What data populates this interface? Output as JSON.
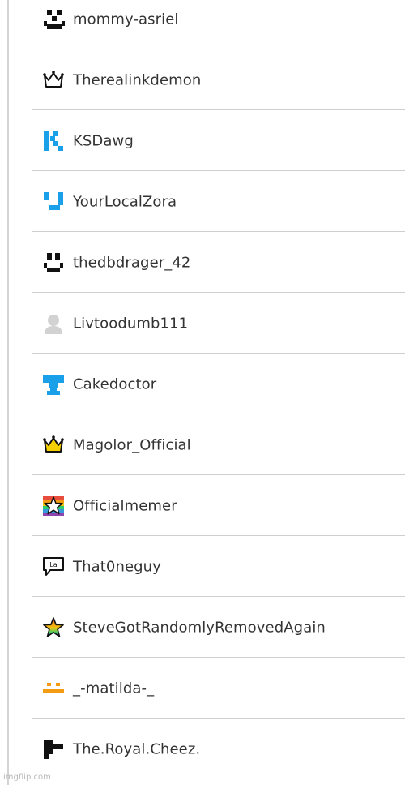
{
  "users": [
    {
      "name": "mommy-asriel",
      "icon": "pixel-face-icon"
    },
    {
      "name": "Therealinkdemon",
      "icon": "crown-icon"
    },
    {
      "name": "KSDawg",
      "icon": "blue-pixel-k-icon"
    },
    {
      "name": "YourLocalZora",
      "icon": "blue-pixel-smile-icon"
    },
    {
      "name": "thedbdrager_42",
      "icon": "pixel-smile-icon"
    },
    {
      "name": "Livtoodumb111",
      "icon": "default-avatar-icon"
    },
    {
      "name": "Cakedoctor",
      "icon": "blue-trophy-icon"
    },
    {
      "name": "Magolor_Official",
      "icon": "gold-crown-icon"
    },
    {
      "name": "Officialmemer",
      "icon": "rainbow-star-icon"
    },
    {
      "name": "That0neguy",
      "icon": "speech-bubble-icon"
    },
    {
      "name": "SteveGotRandomlyRemovedAgain",
      "icon": "rainbow-star-icon"
    },
    {
      "name": "_-matilda-_",
      "icon": "orange-pixel-face-icon"
    },
    {
      "name": "The.Royal.Cheez.",
      "icon": "pixel-flag-icon"
    }
  ],
  "watermark": "imgflip.com",
  "colors": {
    "separator": "#cfcfcf",
    "text": "#333333",
    "accent_blue": "#1aa0e8",
    "accent_orange": "#f39c12",
    "gold": "#f5d000"
  }
}
